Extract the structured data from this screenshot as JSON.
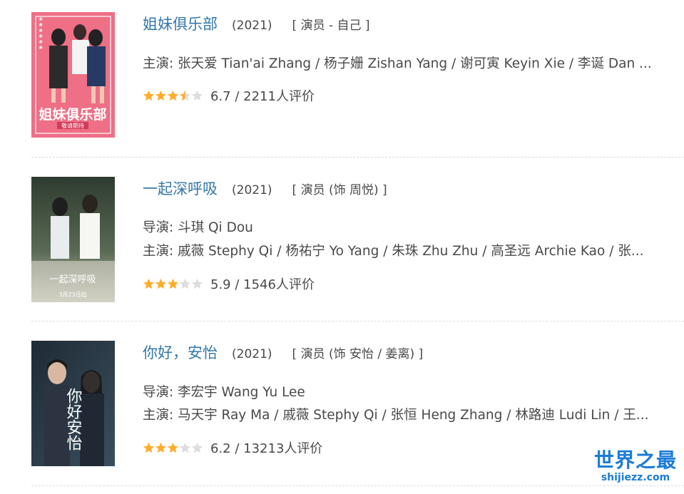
{
  "items": [
    {
      "title": "姐妹俱乐部",
      "year": "(2021)",
      "role": "[ 演员 - 自己 ]",
      "director": "",
      "cast": "主演: 张天爱 Tian'ai Zhang / 杨子姗 Zishan Yang / 谢可寅 Keyin Xie / 李诞 Dan ...",
      "score": "6.7 / 2211人评价",
      "stars": 3.5,
      "poster": {
        "text": "姐妹俱乐部",
        "sub": "敬请期待",
        "bg": "#ee6f86"
      }
    },
    {
      "title": "一起深呼吸",
      "year": "(2021)",
      "role": "[ 演员 (饰 周悦) ]",
      "director": "导演: 斗琪 Qi Dou",
      "cast": "主演: 戚薇 Stephy Qi / 杨祐宁 Yo Yang / 朱珠 Zhu Zhu / 高圣远 Archie Kao / 张...",
      "score": "5.9 / 1546人评价",
      "stars": 3,
      "poster": {
        "text": "一起深呼吸",
        "sub": "3月23日起",
        "bg": "#3e4a3d"
      }
    },
    {
      "title": "你好，安怡",
      "year": "(2021)",
      "role": "[ 演员 (饰 安怡 / 姜离) ]",
      "director": "导演: 李宏宇 Wang Yu Lee",
      "cast": "主演: 马天宇 Ray Ma / 戚薇 Stephy Qi / 张恒 Heng Zhang / 林路迪 Ludi Lin / 王...",
      "score": "6.2 / 13213人评价",
      "stars": 3,
      "poster": {
        "text": "你好安怡",
        "sub": "",
        "bg": "#23303a"
      }
    }
  ],
  "watermark": {
    "main": "世界之最",
    "sub": "shijiezz.com"
  },
  "colors": {
    "title": "#3377aa",
    "star_filled": "#ffac2d",
    "star_empty": "#dddddd",
    "watermark": "#1c7cd6"
  }
}
